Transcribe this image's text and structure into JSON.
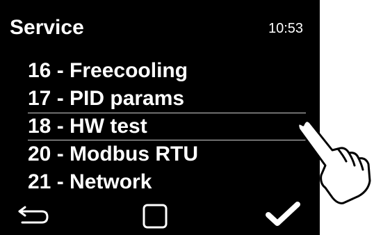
{
  "header": {
    "title": "Service",
    "time": "10:53"
  },
  "menu": {
    "items": [
      {
        "label": "16 - Freecooling"
      },
      {
        "label": "17 - PID params"
      },
      {
        "label": "18 - HW test"
      },
      {
        "label": "20 - Modbus RTU"
      },
      {
        "label": "21 - Network"
      }
    ],
    "selected_index": 2
  },
  "footer": {
    "back_icon": "back-arrow-icon",
    "home_icon": "square-icon",
    "confirm_icon": "checkmark-icon"
  },
  "overlay": {
    "icon": "pointing-hand-icon"
  },
  "colors": {
    "background": "#000000",
    "text": "#ffffff",
    "selection_line": "#cfcfcf"
  }
}
